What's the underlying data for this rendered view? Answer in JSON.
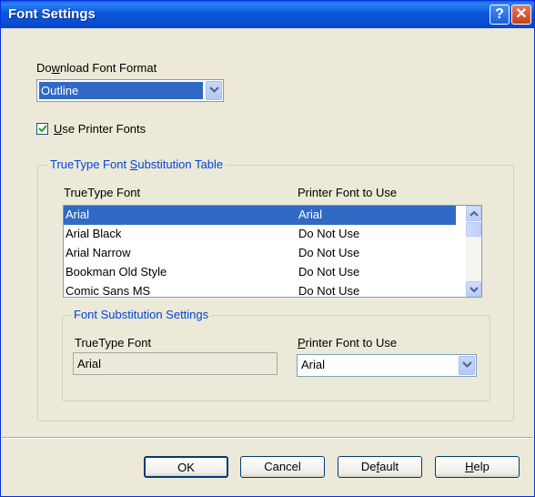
{
  "window": {
    "title": "Font Settings",
    "help_glyph": "?",
    "close_glyph": "✕"
  },
  "download_format": {
    "label_pre": "Do",
    "label_u": "w",
    "label_post": "nload Font Format",
    "selected": "Outline"
  },
  "use_printer_fonts": {
    "checked": true,
    "label_u": "U",
    "label_post": "se Printer Fonts"
  },
  "substitution_table": {
    "legend_pre": "TrueType Font ",
    "legend_u": "S",
    "legend_post": "ubstitution Table",
    "columns": [
      "TrueType Font",
      "Printer Font to Use"
    ],
    "rows": [
      {
        "truetype": "Arial",
        "printer": "Arial",
        "selected": true
      },
      {
        "truetype": "Arial Black",
        "printer": "Do Not Use"
      },
      {
        "truetype": "Arial Narrow",
        "printer": "Do Not Use"
      },
      {
        "truetype": "Bookman Old Style",
        "printer": "Do Not Use"
      },
      {
        "truetype": "Comic Sans MS",
        "printer": "Do Not Use"
      }
    ]
  },
  "substitution_settings": {
    "legend": "Font Substitution Settings",
    "truetype_label": "TrueType Font",
    "truetype_value": "Arial",
    "printer_label_u": "P",
    "printer_label_post": "rinter Font to Use",
    "printer_value": "Arial"
  },
  "buttons": {
    "ok": "OK",
    "cancel": "Cancel",
    "default_pre": "De",
    "default_u": "f",
    "default_post": "ault",
    "help_u": "H",
    "help_post": "elp"
  }
}
